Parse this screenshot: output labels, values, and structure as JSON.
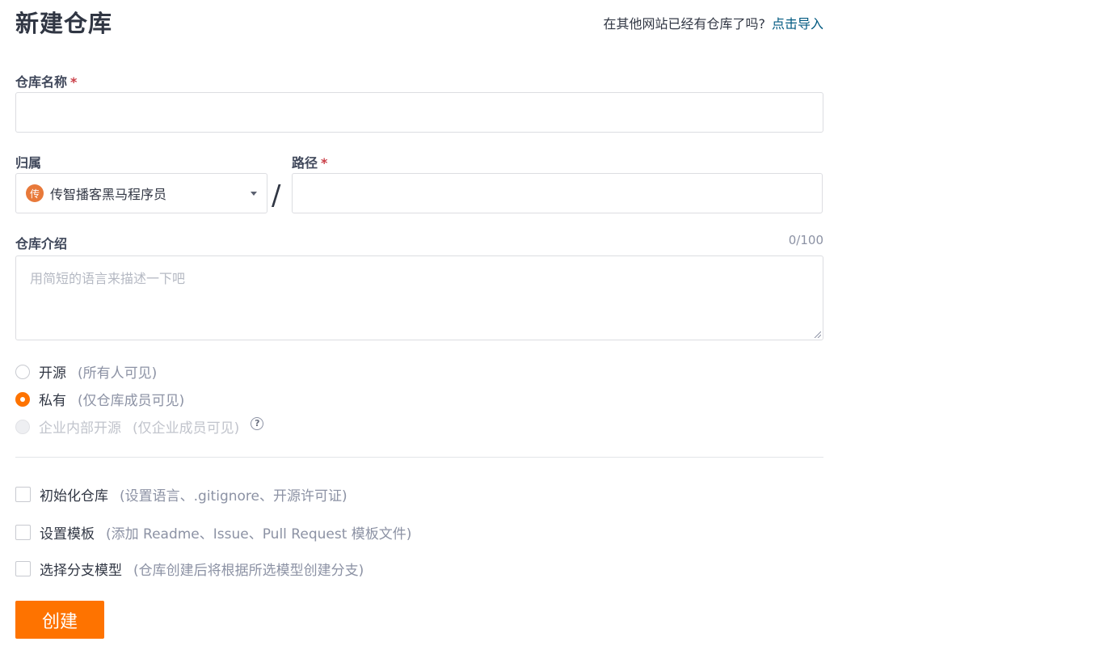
{
  "header": {
    "title": "新建仓库",
    "import_hint": "在其他网站已经有仓库了吗?",
    "import_link": "点击导入"
  },
  "form": {
    "repo_name_label": "仓库名称",
    "required_mark": "*",
    "repo_name_value": "",
    "owner_label": "归属",
    "owner_avatar_text": "传",
    "owner_value": "传智播客黑马程序员",
    "path_separator": "/",
    "path_label": "路径",
    "path_value": "",
    "description_label": "仓库介绍",
    "description_counter": "0/100",
    "description_placeholder": "用简短的语言来描述一下吧"
  },
  "visibility": {
    "options": [
      {
        "label": "开源",
        "hint": "(所有人可见)",
        "state": "unchecked"
      },
      {
        "label": "私有",
        "hint": "(仅仓库成员可见)",
        "state": "checked"
      },
      {
        "label": "企业内部开源",
        "hint": "(仅企业成员可见)",
        "state": "disabled"
      }
    ],
    "help_glyph": "?"
  },
  "options": {
    "items": [
      {
        "label": "初始化仓库",
        "hint": "(设置语言、.gitignore、开源许可证)"
      },
      {
        "label": "设置模板",
        "hint": "(添加 Readme、Issue、Pull Request 模板文件)"
      },
      {
        "label": "选择分支模型",
        "hint": "(仓库创建后将根据所选模型创建分支)"
      }
    ]
  },
  "actions": {
    "create_label": "创建"
  },
  "colors": {
    "accent": "#fe7300",
    "link": "#005980",
    "required": "#ca3e47"
  },
  "icons": {
    "owner_dropdown": "chevron-down-icon",
    "help": "question-circle-icon",
    "resize": "resize-grip-icon"
  }
}
